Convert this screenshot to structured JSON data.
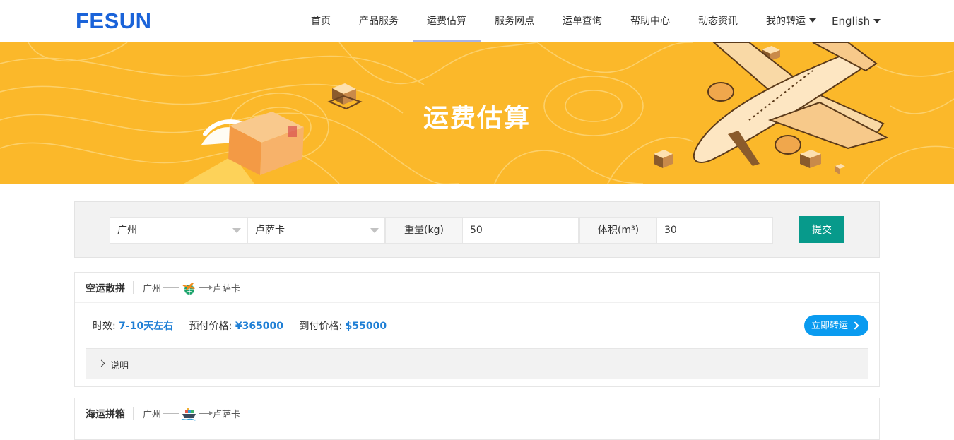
{
  "header": {
    "logo": "FESUN",
    "nav": [
      {
        "label": "首页"
      },
      {
        "label": "产品服务"
      },
      {
        "label": "运费估算"
      },
      {
        "label": "服务网点"
      },
      {
        "label": "运单查询"
      },
      {
        "label": "帮助中心"
      },
      {
        "label": "动态资讯"
      },
      {
        "label": "我的转运"
      }
    ],
    "active_index": 2,
    "language": "English"
  },
  "banner": {
    "title": "运费估算"
  },
  "search": {
    "origin": "广州",
    "destination": "卢萨卡",
    "weight_label": "重量(kg)",
    "weight_value": "50",
    "volume_label": "体积(m³)",
    "volume_value": "30",
    "submit_label": "提交"
  },
  "results": [
    {
      "title": "空运散拼",
      "from": "广州",
      "to": "卢萨卡",
      "mode_icon": "airplane-globe-icon",
      "time_label": "时效:",
      "time_value": "7-10天左右",
      "prepaid_label": "预付价格:",
      "prepaid_value": "¥365000",
      "cod_label": "到付价格:",
      "cod_value": "$55000",
      "action_label": "立即转运",
      "note_label": "说明"
    },
    {
      "title": "海运拼箱",
      "from": "广州",
      "to": "卢萨卡",
      "mode_icon": "cargo-ship-icon"
    }
  ],
  "colors": {
    "brand": "#1a63d9",
    "banner": "#fbb82a",
    "submit": "#079a8b",
    "accent_value": "#1f7fd5",
    "action_button": "#0a9bf0"
  }
}
